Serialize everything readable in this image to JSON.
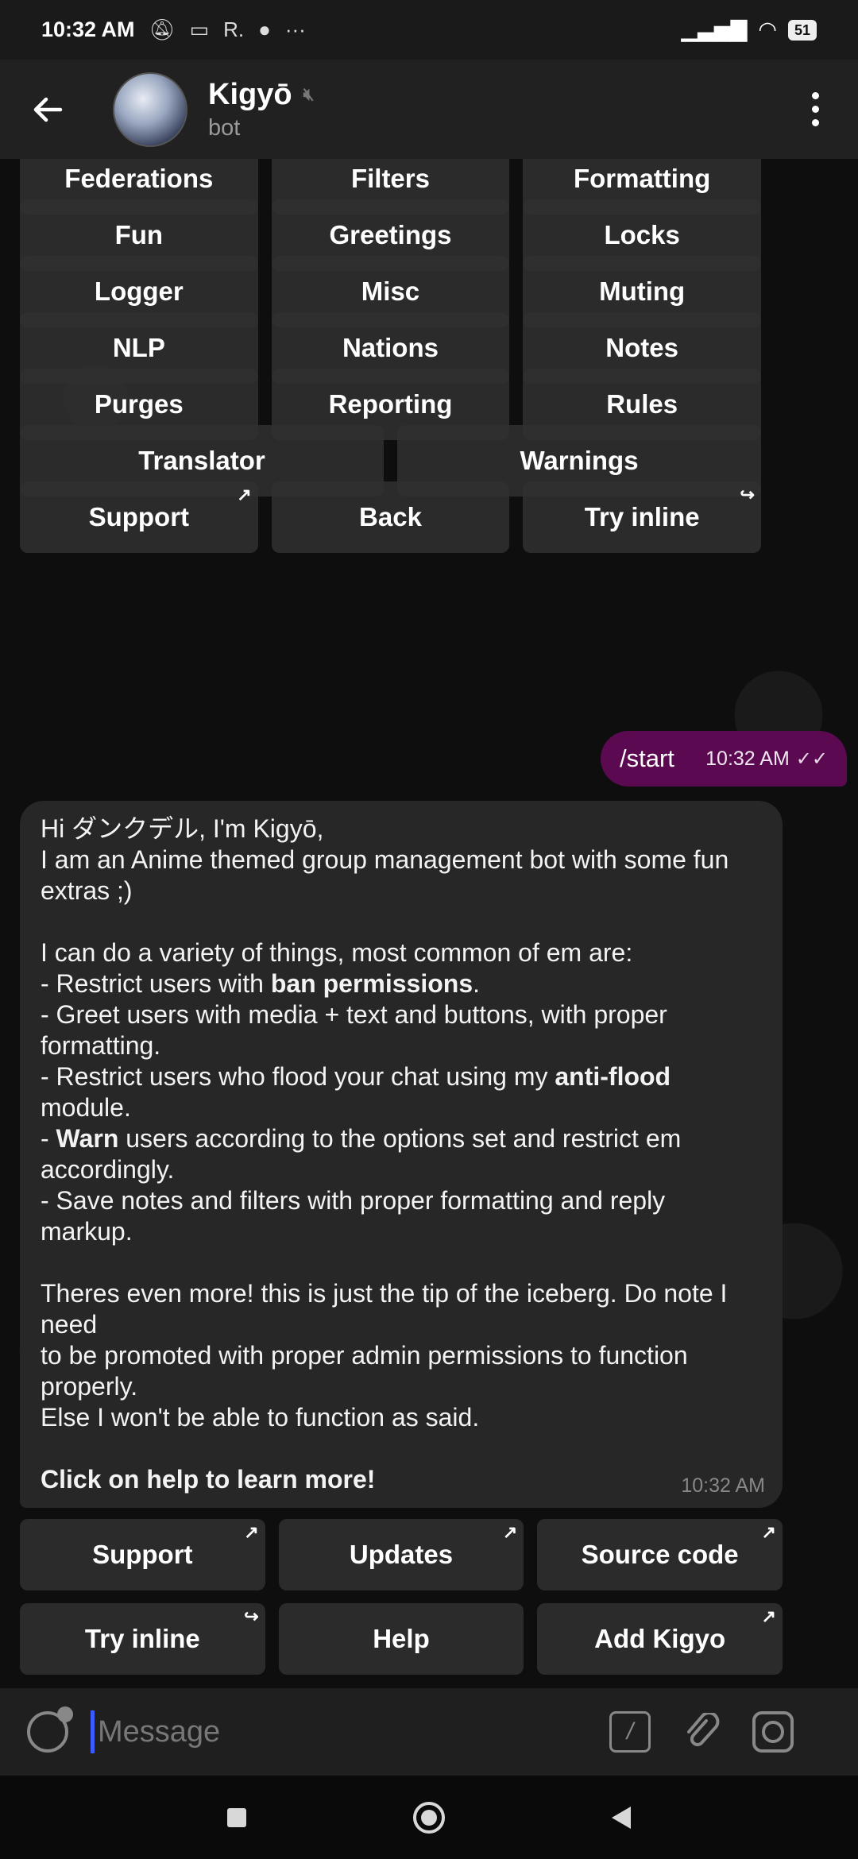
{
  "status": {
    "time": "10:32 AM",
    "indicators": [
      "mute-icon",
      "cast-icon",
      "R.",
      "reddit-icon",
      "···"
    ],
    "battery": "51"
  },
  "header": {
    "name": "Kigyō",
    "subtitle": "bot"
  },
  "keyboard_top": [
    [
      "Federations",
      "Filters",
      "Formatting"
    ],
    [
      "Fun",
      "Greetings",
      "Locks"
    ],
    [
      "Logger",
      "Misc",
      "Muting"
    ],
    [
      "NLP",
      "Nations",
      "Notes"
    ],
    [
      "Purges",
      "Reporting",
      "Rules"
    ],
    [
      "Translator",
      "Warnings"
    ],
    [
      "Support",
      "Back",
      "Try inline"
    ]
  ],
  "outgoing": {
    "text": "/start",
    "time": "10:32 AM"
  },
  "incoming": {
    "lines": [
      "Hi ダンクデル, I'm Kigyō,",
      "I am an Anime themed group management bot with some fun",
      "extras ;)",
      "",
      "I can do a variety of things, most common of em are:",
      "- Restrict users with |ban permissions|.",
      "- Greet users with media + text and buttons, with proper",
      "formatting.",
      "- Restrict users who flood your chat using my |anti-flood|",
      "module.",
      "- |Warn| users according to the options set and restrict em",
      "accordingly.",
      "- Save notes and filters with proper formatting and reply",
      "markup.",
      "",
      "Theres even more! this is just the tip of the iceberg. Do note I",
      "need",
      "to be promoted with proper admin permissions to function",
      "properly.",
      "Else I won't be able to function as said.",
      "",
      "|Click on help to learn more!|"
    ],
    "time": "10:32 AM"
  },
  "keyboard_bottom": [
    [
      "Support",
      "Updates",
      "Source code"
    ],
    [
      "Try inline",
      "Help",
      "Add Kigyo"
    ]
  ],
  "input": {
    "placeholder": "Message"
  }
}
